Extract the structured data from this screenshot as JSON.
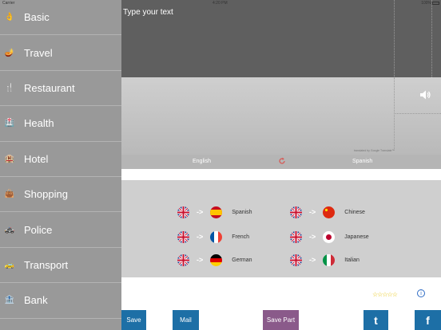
{
  "status": {
    "carrier": "Carrier",
    "time": "4:20 PM",
    "battery": "100%"
  },
  "sidebar": {
    "items": [
      {
        "label": "Basic",
        "icon": "hand-ok-icon"
      },
      {
        "label": "Travel",
        "icon": "lamp-icon"
      },
      {
        "label": "Restaurant",
        "icon": "fork-icon"
      },
      {
        "label": "Health",
        "icon": "hospital-icon"
      },
      {
        "label": "Hotel",
        "icon": "hotel-icon"
      },
      {
        "label": "Shopping",
        "icon": "shopping-bag-icon"
      },
      {
        "label": "Police",
        "icon": "police-car-icon"
      },
      {
        "label": "Transport",
        "icon": "taxi-icon"
      },
      {
        "label": "Bank",
        "icon": "bank-icon"
      }
    ]
  },
  "editor": {
    "placeholder": "Type your text",
    "credit": "translated by Google Translate™"
  },
  "language_bar": {
    "source": "English",
    "target": "Spanish"
  },
  "pairs": [
    {
      "from": "uk-flag-icon",
      "to": "spain-flag-icon",
      "label": "Spanish"
    },
    {
      "from": "uk-flag-icon",
      "to": "france-flag-icon",
      "label": "French"
    },
    {
      "from": "uk-flag-icon",
      "to": "germany-flag-icon",
      "label": "German"
    },
    {
      "from": "uk-flag-icon",
      "to": "china-flag-icon",
      "label": "Chinese"
    },
    {
      "from": "uk-flag-icon",
      "to": "japan-flag-icon",
      "label": "Japanese"
    },
    {
      "from": "uk-flag-icon",
      "to": "italy-flag-icon",
      "label": "Italian"
    }
  ],
  "arrow_text": "->",
  "rating": "☆☆☆☆☆",
  "info": "i",
  "buttons": {
    "save": "Save",
    "mail": "Mail",
    "save_part": "Save Part",
    "twitter": "t",
    "facebook": "f"
  },
  "colors": {
    "sidebar": "#999999",
    "editor": "#5f5f5f",
    "button_blue": "#1d6fa6",
    "button_purple": "#8a5a8a"
  }
}
